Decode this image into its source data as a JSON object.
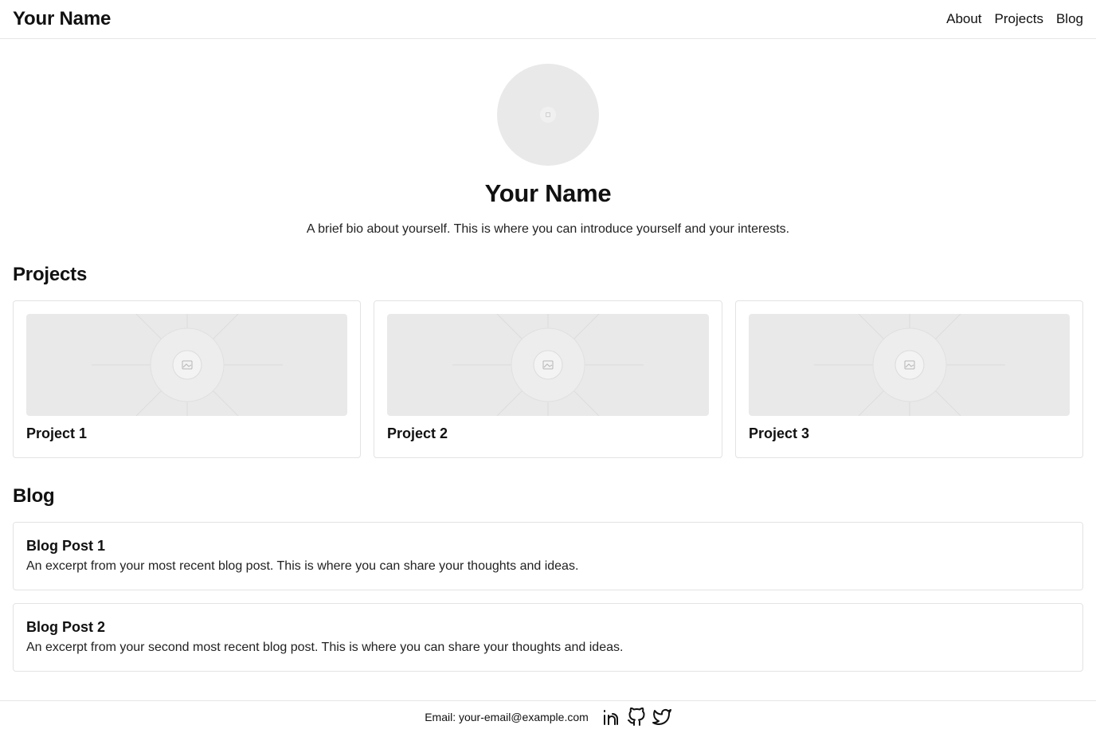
{
  "header": {
    "brand": "Your Name",
    "nav": [
      "About",
      "Projects",
      "Blog"
    ]
  },
  "hero": {
    "name": "Your Name",
    "bio": "A brief bio about yourself. This is where you can introduce yourself and your interests."
  },
  "projects": {
    "title": "Projects",
    "items": [
      {
        "title": "Project 1"
      },
      {
        "title": "Project 2"
      },
      {
        "title": "Project 3"
      }
    ]
  },
  "blog": {
    "title": "Blog",
    "posts": [
      {
        "title": "Blog Post 1",
        "excerpt": "An excerpt from your most recent blog post. This is where you can share your thoughts and ideas."
      },
      {
        "title": "Blog Post 2",
        "excerpt": "An excerpt from your second most recent blog post. This is where you can share your thoughts and ideas."
      }
    ]
  },
  "footer": {
    "email": "Email: your-email@example.com",
    "social_icons": [
      "linkedin-icon",
      "github-icon",
      "twitter-icon"
    ]
  },
  "colors": {
    "border": "#e3e3e3",
    "placeholder": "#e9e9e9",
    "text": "#111111"
  }
}
